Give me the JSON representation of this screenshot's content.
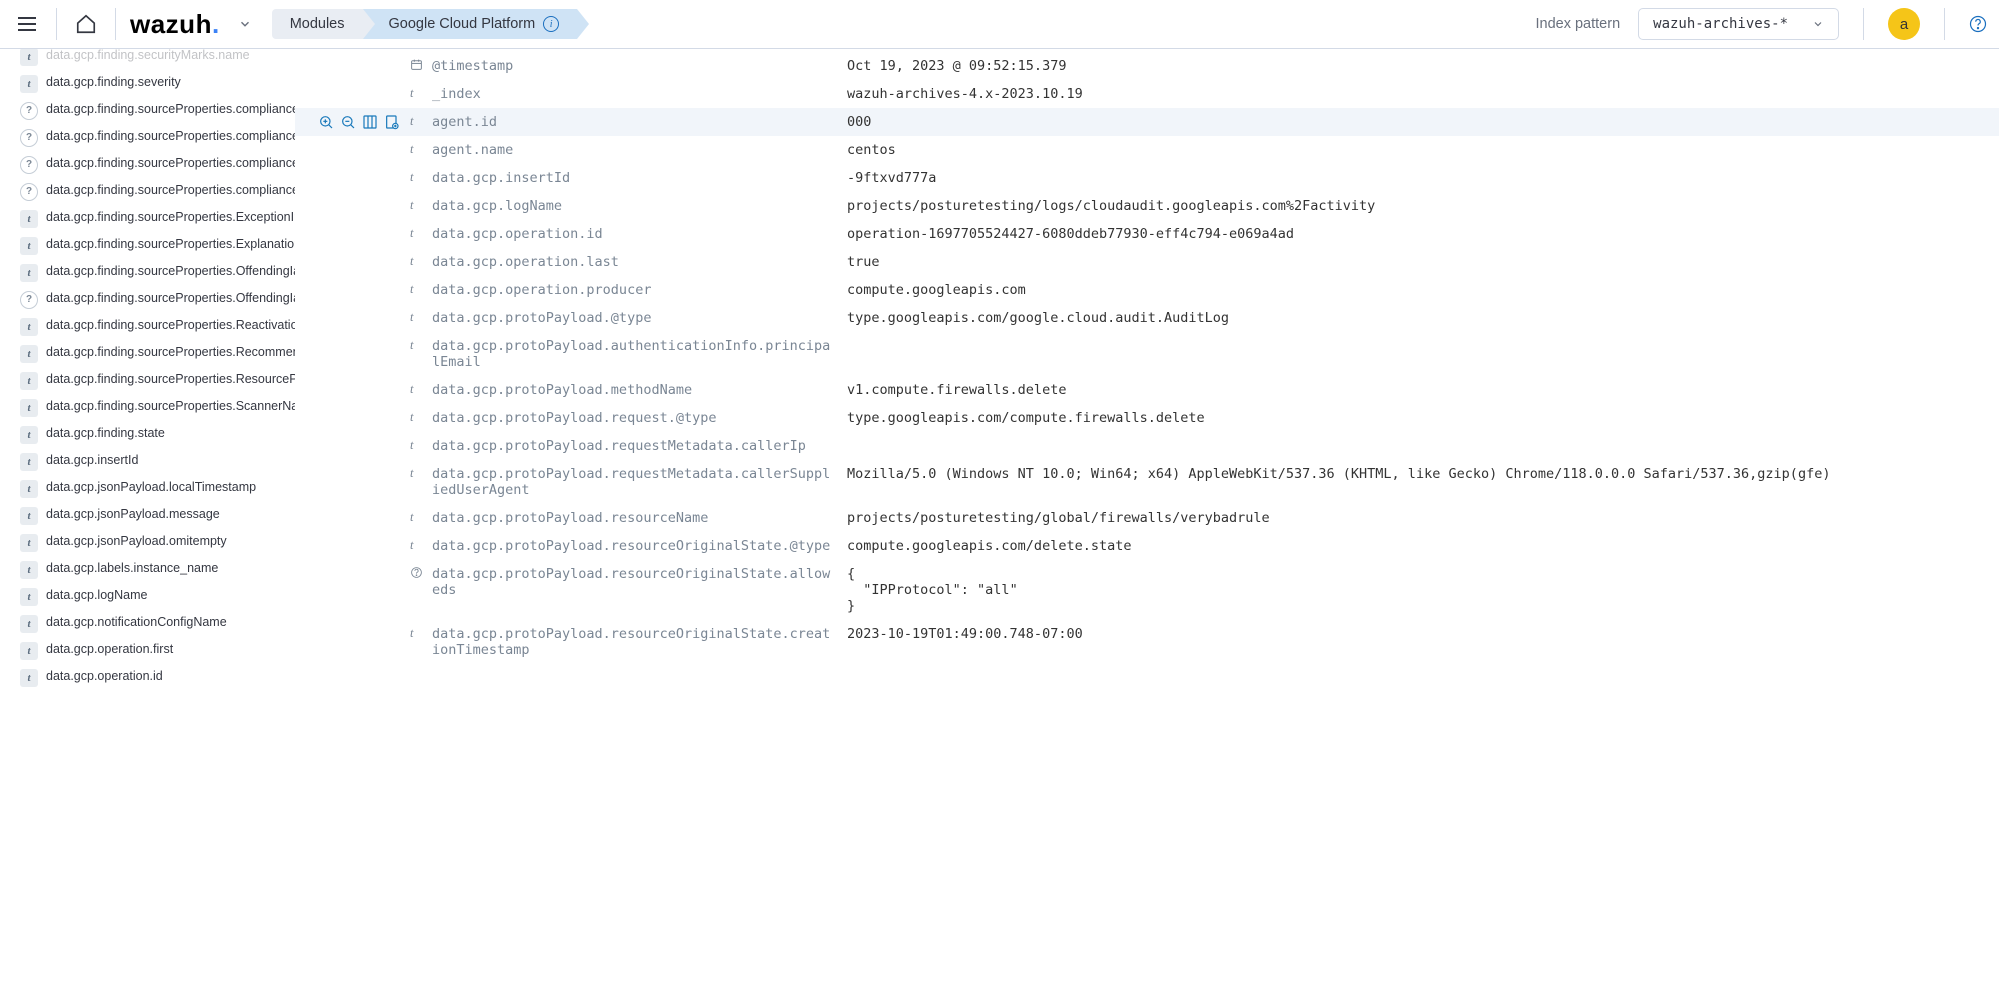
{
  "topbar": {
    "logo_text": "wazuh",
    "modules_label": "Modules",
    "active_module": "Google Cloud Platform",
    "index_pattern_label": "Index pattern",
    "index_pattern_value": "wazuh-archives-*",
    "avatar_letter": "a"
  },
  "sidebar_fields": [
    {
      "type": "t",
      "name": "data.gcp.finding.securityMarks.name",
      "truncated": true
    },
    {
      "type": "t",
      "name": "data.gcp.finding.severity"
    },
    {
      "type": "q",
      "name": "data.gcp.finding.sourceProperties.compliance_standards.cis"
    },
    {
      "type": "q",
      "name": "data.gcp.finding.sourceProperties.compliance_standards.iso"
    },
    {
      "type": "q",
      "name": "data.gcp.finding.sourceProperties.compliance_standards.nist"
    },
    {
      "type": "q",
      "name": "data.gcp.finding.sourceProperties.compliance_standards.pci"
    },
    {
      "type": "t",
      "name": "data.gcp.finding.sourceProperties.ExceptionInstructions"
    },
    {
      "type": "t",
      "name": "data.gcp.finding.sourceProperties.Explanation"
    },
    {
      "type": "t",
      "name": "data.gcp.finding.sourceProperties.OffendingIamRoles"
    },
    {
      "type": "q",
      "name": "data.gcp.finding.sourceProperties.OffendingIamRolesList"
    },
    {
      "type": "t",
      "name": "data.gcp.finding.sourceProperties.ReactivationCount"
    },
    {
      "type": "t",
      "name": "data.gcp.finding.sourceProperties.Recommendation"
    },
    {
      "type": "t",
      "name": "data.gcp.finding.sourceProperties.ResourcePath"
    },
    {
      "type": "t",
      "name": "data.gcp.finding.sourceProperties.ScannerName"
    },
    {
      "type": "t",
      "name": "data.gcp.finding.state"
    },
    {
      "type": "t",
      "name": "data.gcp.insertId"
    },
    {
      "type": "t",
      "name": "data.gcp.jsonPayload.localTimestamp"
    },
    {
      "type": "t",
      "name": "data.gcp.jsonPayload.message"
    },
    {
      "type": "t",
      "name": "data.gcp.jsonPayload.omitempty"
    },
    {
      "type": "t",
      "name": "data.gcp.labels.instance_name"
    },
    {
      "type": "t",
      "name": "data.gcp.logName"
    },
    {
      "type": "t",
      "name": "data.gcp.notificationConfigName"
    },
    {
      "type": "t",
      "name": "data.gcp.operation.first"
    },
    {
      "type": "t",
      "name": "data.gcp.operation.id"
    }
  ],
  "doc_fields": [
    {
      "type": "cal",
      "name": "@timestamp",
      "value": "Oct 19, 2023 @ 09:52:15.379"
    },
    {
      "type": "t",
      "name": "_index",
      "value": "wazuh-archives-4.x-2023.10.19"
    },
    {
      "type": "t",
      "name": "agent.id",
      "value": "000",
      "highlight": true
    },
    {
      "type": "t",
      "name": "agent.name",
      "value": "centos"
    },
    {
      "type": "t",
      "name": "data.gcp.insertId",
      "value": "-9ftxvd777a"
    },
    {
      "type": "t",
      "name": "data.gcp.logName",
      "value": "projects/posturetesting/logs/cloudaudit.googleapis.com%2Factivity"
    },
    {
      "type": "t",
      "name": "data.gcp.operation.id",
      "value": "operation-1697705524427-6080ddeb77930-eff4c794-e069a4ad"
    },
    {
      "type": "t",
      "name": "data.gcp.operation.last",
      "value": "true"
    },
    {
      "type": "t",
      "name": "data.gcp.operation.producer",
      "value": "compute.googleapis.com"
    },
    {
      "type": "t",
      "name": "data.gcp.protoPayload.@type",
      "value": "type.googleapis.com/google.cloud.audit.AuditLog"
    },
    {
      "type": "t",
      "name": "data.gcp.protoPayload.authenticationInfo.principalEmail",
      "value": ""
    },
    {
      "type": "t",
      "name": "data.gcp.protoPayload.methodName",
      "value": "v1.compute.firewalls.delete"
    },
    {
      "type": "t",
      "name": "data.gcp.protoPayload.request.@type",
      "value": "type.googleapis.com/compute.firewalls.delete"
    },
    {
      "type": "t",
      "name": "data.gcp.protoPayload.requestMetadata.callerIp",
      "value": ""
    },
    {
      "type": "t",
      "name": "data.gcp.protoPayload.requestMetadata.callerSuppliedUserAgent",
      "value": "Mozilla/5.0 (Windows NT 10.0; Win64; x64) AppleWebKit/537.36 (KHTML, like Gecko) Chrome/118.0.0.0 Safari/537.36,gzip(gfe)"
    },
    {
      "type": "t",
      "name": "data.gcp.protoPayload.resourceName",
      "value": "projects/posturetesting/global/firewalls/verybadrule"
    },
    {
      "type": "t",
      "name": "data.gcp.protoPayload.resourceOriginalState.@type",
      "value": "compute.googleapis.com/delete.state"
    },
    {
      "type": "q",
      "name": "data.gcp.protoPayload.resourceOriginalState.alloweds",
      "value": "{\n  \"IPProtocol\": \"all\"\n}"
    },
    {
      "type": "t",
      "name": "data.gcp.protoPayload.resourceOriginalState.creationTimestamp",
      "value": "2023-10-19T01:49:00.748-07:00"
    }
  ]
}
